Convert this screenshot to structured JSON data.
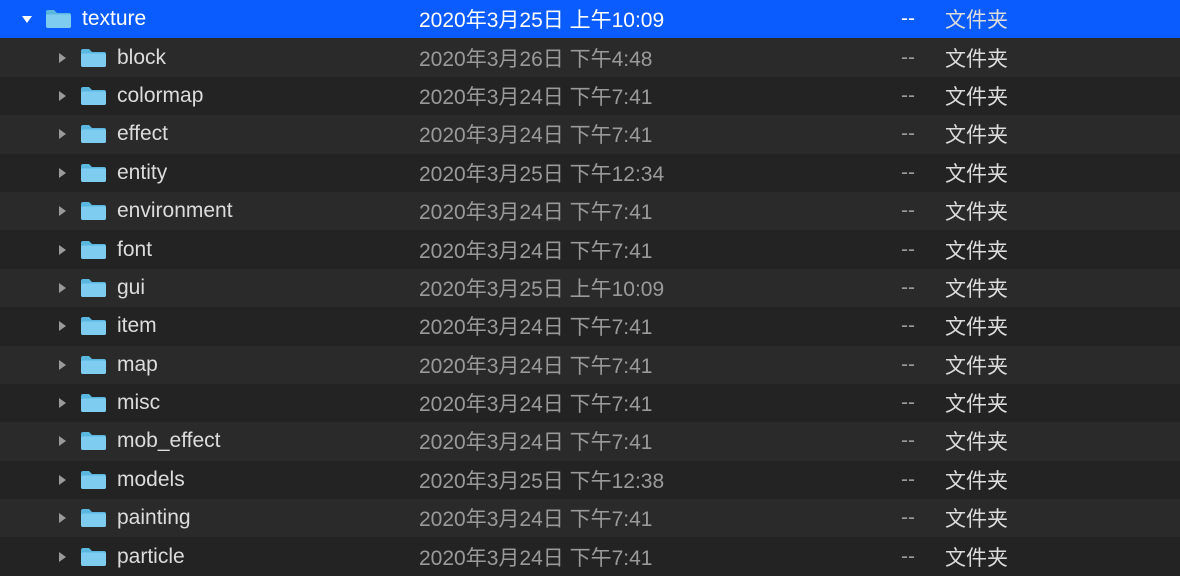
{
  "rows": [
    {
      "name": "texture",
      "date": "2020年3月25日 上午10:09",
      "size": "--",
      "kind": "文件夹",
      "expanded": true,
      "selected": true,
      "depth": 0
    },
    {
      "name": "block",
      "date": "2020年3月26日 下午4:48",
      "size": "--",
      "kind": "文件夹",
      "expanded": false,
      "selected": false,
      "depth": 1
    },
    {
      "name": "colormap",
      "date": "2020年3月24日 下午7:41",
      "size": "--",
      "kind": "文件夹",
      "expanded": false,
      "selected": false,
      "depth": 1
    },
    {
      "name": "effect",
      "date": "2020年3月24日 下午7:41",
      "size": "--",
      "kind": "文件夹",
      "expanded": false,
      "selected": false,
      "depth": 1
    },
    {
      "name": "entity",
      "date": "2020年3月25日 下午12:34",
      "size": "--",
      "kind": "文件夹",
      "expanded": false,
      "selected": false,
      "depth": 1
    },
    {
      "name": "environment",
      "date": "2020年3月24日 下午7:41",
      "size": "--",
      "kind": "文件夹",
      "expanded": false,
      "selected": false,
      "depth": 1
    },
    {
      "name": "font",
      "date": "2020年3月24日 下午7:41",
      "size": "--",
      "kind": "文件夹",
      "expanded": false,
      "selected": false,
      "depth": 1
    },
    {
      "name": "gui",
      "date": "2020年3月25日 上午10:09",
      "size": "--",
      "kind": "文件夹",
      "expanded": false,
      "selected": false,
      "depth": 1
    },
    {
      "name": "item",
      "date": "2020年3月24日 下午7:41",
      "size": "--",
      "kind": "文件夹",
      "expanded": false,
      "selected": false,
      "depth": 1
    },
    {
      "name": "map",
      "date": "2020年3月24日 下午7:41",
      "size": "--",
      "kind": "文件夹",
      "expanded": false,
      "selected": false,
      "depth": 1
    },
    {
      "name": "misc",
      "date": "2020年3月24日 下午7:41",
      "size": "--",
      "kind": "文件夹",
      "expanded": false,
      "selected": false,
      "depth": 1
    },
    {
      "name": "mob_effect",
      "date": "2020年3月24日 下午7:41",
      "size": "--",
      "kind": "文件夹",
      "expanded": false,
      "selected": false,
      "depth": 1
    },
    {
      "name": "models",
      "date": "2020年3月25日 下午12:38",
      "size": "--",
      "kind": "文件夹",
      "expanded": false,
      "selected": false,
      "depth": 1
    },
    {
      "name": "painting",
      "date": "2020年3月24日 下午7:41",
      "size": "--",
      "kind": "文件夹",
      "expanded": false,
      "selected": false,
      "depth": 1
    },
    {
      "name": "particle",
      "date": "2020年3月24日 下午7:41",
      "size": "--",
      "kind": "文件夹",
      "expanded": false,
      "selected": false,
      "depth": 1
    }
  ]
}
